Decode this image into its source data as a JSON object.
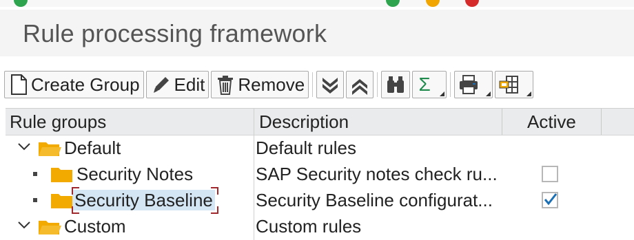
{
  "page": {
    "title": "Rule processing framework"
  },
  "toolbar": {
    "create_group": "Create Group",
    "edit": "Edit",
    "remove": "Remove"
  },
  "table": {
    "headers": {
      "groups": "Rule groups",
      "description": "Description",
      "active": "Active"
    },
    "rows": [
      {
        "label": "Default",
        "description": "Default rules",
        "level": 0,
        "expanded": true,
        "icon": "folder-open-icon"
      },
      {
        "label": "Security Notes",
        "description": "SAP Security notes check ru...",
        "level": 1,
        "active": false,
        "icon": "folder-icon"
      },
      {
        "label": "Security Baseline",
        "description": "Security Baseline configurat...",
        "level": 1,
        "active": true,
        "selected": true,
        "icon": "folder-icon"
      },
      {
        "label": "Custom",
        "description": "Custom rules",
        "level": 0,
        "expanded": true,
        "icon": "folder-open-icon"
      }
    ]
  },
  "colors": {
    "folder": "#f2a900",
    "selection": "#d4e6f4",
    "check": "#1b6fb5",
    "focus": "#a0282c"
  }
}
